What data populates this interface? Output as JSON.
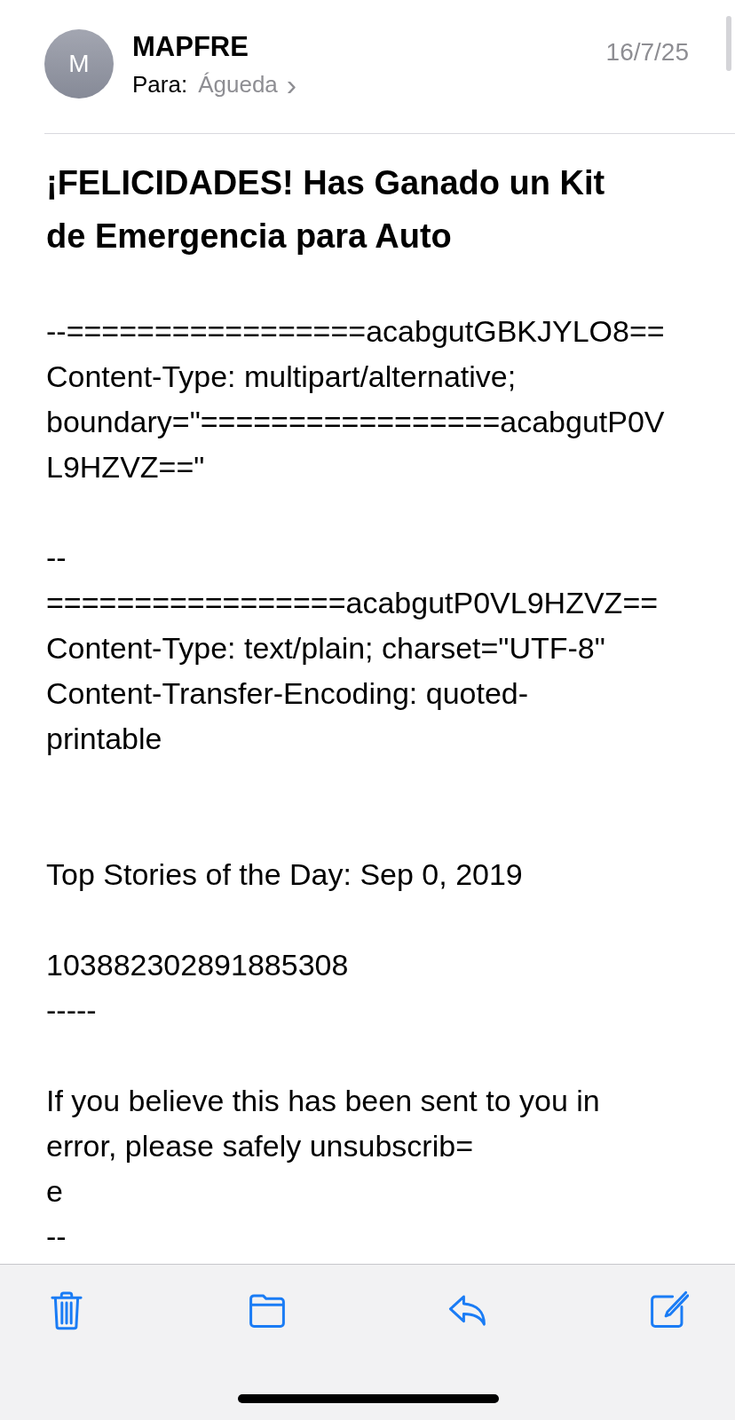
{
  "sender": {
    "initial": "M",
    "name": "MAPFRE",
    "to_label": "Para:",
    "to_name": "Águeda",
    "chevron": "›",
    "date": "16/7/25"
  },
  "subject": "¡FELICIDADES! Has Ganado un Kit de Emergencia para Auto",
  "body": [
    {
      "lines": [
        "--=================acabgutGBKJYLO8==",
        "Content-Type: multipart/alternative;",
        "boundary=\"=================acabgutP0V",
        "L9HZVZ==\""
      ]
    },
    {
      "lines": [
        "--",
        "=================acabgutP0VL9HZVZ==",
        "Content-Type: text/plain; charset=\"UTF-8\"",
        "Content-Transfer-Encoding: quoted-",
        "printable"
      ]
    },
    {
      "lines": [
        "Top Stories of the Day: Sep 0, 2019"
      ]
    },
    {
      "lines": [
        "103882302891885308",
        "-----"
      ]
    },
    {
      "lines": [
        "If you believe this has been sent to you in",
        "error, please safely unsubscrib=",
        "e",
        "--"
      ]
    }
  ],
  "toolbar": [
    {
      "kind": "trash"
    },
    {
      "kind": "folder"
    },
    {
      "kind": "reply"
    },
    {
      "kind": "compose"
    }
  ]
}
